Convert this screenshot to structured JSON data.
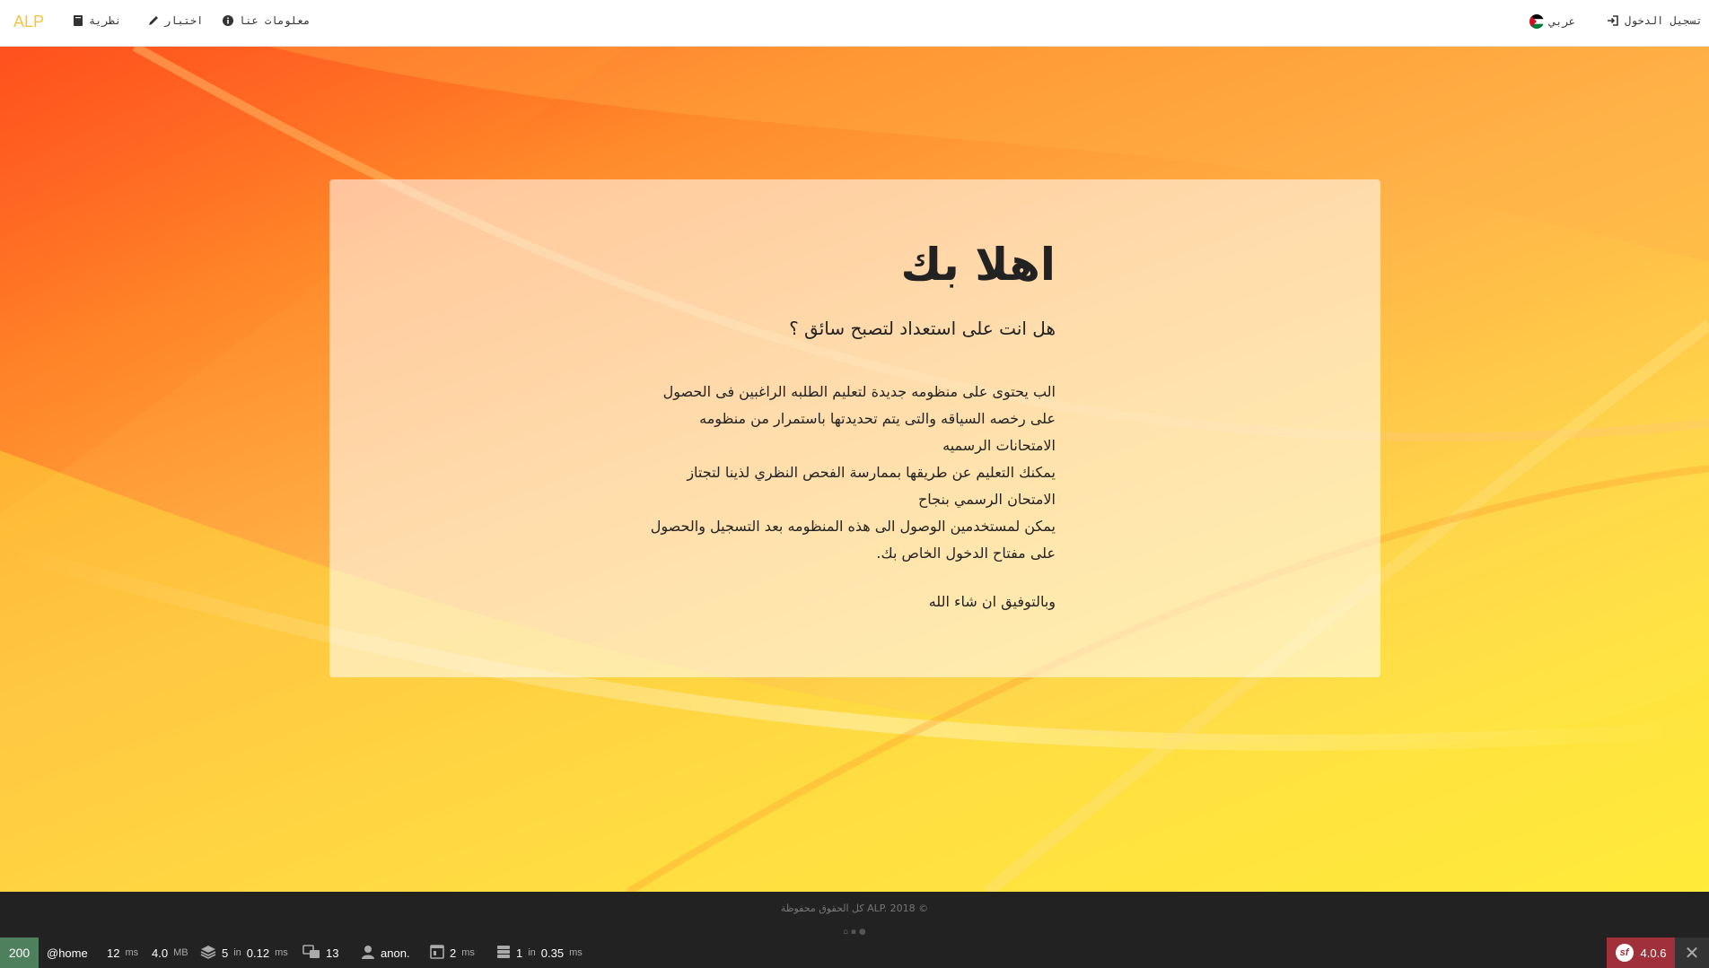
{
  "navbar": {
    "brand": "ALP",
    "items": [
      {
        "label": "نظرية",
        "icon": "book-icon"
      },
      {
        "label": "اختبار",
        "icon": "pencil-icon"
      },
      {
        "label": "معلومات عنا",
        "icon": "info-circle-icon"
      }
    ],
    "language": {
      "label": "عربي",
      "icon": "jordan-flag-icon"
    },
    "login": {
      "label": "تسجيل الدخول",
      "icon": "sign-in-icon"
    }
  },
  "colors": {
    "brand": "#f5c542",
    "footer_bg": "#222222",
    "status_ok": "#4f805d",
    "version_bg": "#a0303a"
  },
  "content": {
    "title": "اهلا بك",
    "subtitle": "هل انت على استعداد لتصبح سائق ؟",
    "lines": [
      "الب يحتوى على منظومه جديدة لتعليم الطلبه الراغبين فى الحصول",
      "على رخصه السياقه والتى يتم تحديدتها باستمرار من منظومه",
      "الامتحانات الرسميه",
      "يمكنك التعليم عن طريقها بممارسة الفحص النظري لذينا لتجتاز",
      "الامتحان الرسمي بنجاح",
      "يمكن لمستخدمين الوصول الى هذه المنظومه بعد التسجيل والحصول",
      "على مفتاح الدخول الخاص بك."
    ],
    "closing": "وبالتوفيق ان شاء الله"
  },
  "footer": {
    "copyright": "كل الحقوق محفوظة ALP. 2018 ©"
  },
  "debug_toolbar": {
    "status_code": "200",
    "route": "@home",
    "time": "12",
    "time_unit": "ms",
    "memory": "4.0",
    "memory_unit": "MB",
    "cache_count": "5",
    "cache_time": "0.12",
    "translations": "13",
    "user": "anon.",
    "twig_time": "2",
    "db_queries": "1",
    "db_time": "0.35",
    "version": "4.0.6",
    "in_word": "in",
    "ms_word": "ms"
  }
}
